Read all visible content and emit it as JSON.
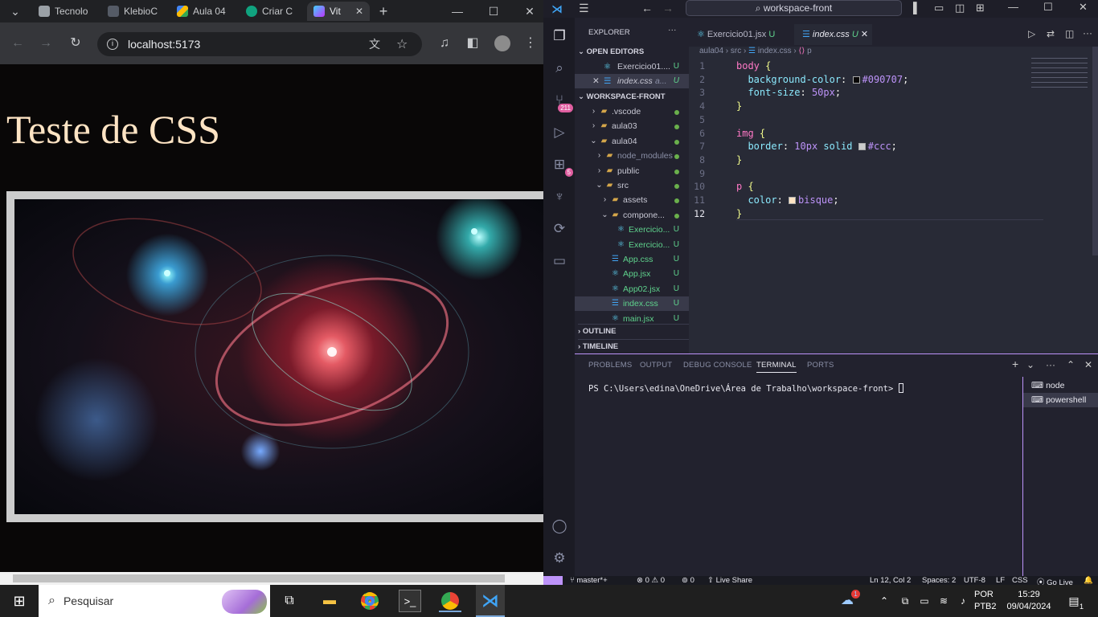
{
  "chrome": {
    "tabs": [
      {
        "label": "Tecnolo",
        "color": "#9aa0a6"
      },
      {
        "label": "KlebioC",
        "color": "#555b66"
      },
      {
        "label": "Aula 04",
        "color": "#4285f4"
      },
      {
        "label": "Criar C",
        "color": "#10a37f"
      },
      {
        "label": "Vit",
        "color": "#a259ff"
      }
    ],
    "new_tab": "+",
    "url": "localhost:5173",
    "page": {
      "heading": "Teste de CSS"
    }
  },
  "vscode": {
    "search": "workspace-front",
    "explorer_title": "EXPLORER",
    "open_editors_title": "OPEN EDITORS",
    "open_editors": [
      {
        "name": "Exercicio01....",
        "status": "U"
      },
      {
        "name": "index.css",
        "dir": "a...",
        "status": "U"
      }
    ],
    "workspace_title": "WORKSPACE-FRONT",
    "tree": [
      {
        "name": ".vscode",
        "kind": "folder",
        "depth": 0
      },
      {
        "name": "aula03",
        "kind": "folder",
        "depth": 0
      },
      {
        "name": "aula04",
        "kind": "folder-open",
        "depth": 0
      },
      {
        "name": "node_modules",
        "kind": "folder",
        "depth": 1
      },
      {
        "name": "public",
        "kind": "folder",
        "depth": 1
      },
      {
        "name": "src",
        "kind": "folder-open",
        "depth": 1
      },
      {
        "name": "assets",
        "kind": "folder",
        "depth": 2
      },
      {
        "name": "compone...",
        "kind": "folder-open",
        "depth": 2
      },
      {
        "name": "Exercicio...",
        "kind": "react",
        "depth": 3,
        "status": "U"
      },
      {
        "name": "Exercicio...",
        "kind": "react",
        "depth": 3,
        "status": "U"
      },
      {
        "name": "App.css",
        "kind": "css",
        "depth": 2,
        "status": "U"
      },
      {
        "name": "App.jsx",
        "kind": "react",
        "depth": 2,
        "status": "U"
      },
      {
        "name": "App02.jsx",
        "kind": "react",
        "depth": 2,
        "status": "U"
      },
      {
        "name": "index.css",
        "kind": "css",
        "depth": 2,
        "status": "U"
      },
      {
        "name": "main.jsx",
        "kind": "react",
        "depth": 2,
        "status": "U"
      }
    ],
    "outline_title": "OUTLINE",
    "timeline_title": "TIMELINE",
    "editor_tabs": [
      {
        "name": "Exercicio01.jsx",
        "status": "U"
      },
      {
        "name": "index.css",
        "status": "U"
      }
    ],
    "breadcrumb": [
      "aula04",
      "src",
      "index.css",
      "p"
    ],
    "code_lines": [
      "1",
      "2",
      "3",
      "4",
      "5",
      "6",
      "7",
      "8",
      "9",
      "10",
      "11",
      "12"
    ],
    "code": {
      "l1": {
        "sel": "body",
        "brace": " {"
      },
      "l2": {
        "prop": "background-color",
        "val": "#090707",
        "swatch": "#090707"
      },
      "l3": {
        "prop": "font-size",
        "val": "50px"
      },
      "l4": "}",
      "l6": {
        "sel": "img",
        "brace": " {"
      },
      "l7": {
        "prop": "border",
        "num": "10px",
        "kw": "solid",
        "val": "#ccc",
        "swatch": "#cccccc"
      },
      "l8": "}",
      "l10": {
        "sel": "p",
        "brace": " {"
      },
      "l11": {
        "prop": "color",
        "val": "bisque",
        "swatch": "#ffe4c4"
      },
      "l12": "}"
    },
    "panel_tabs": [
      "PROBLEMS",
      "OUTPUT",
      "DEBUG CONSOLE",
      "TERMINAL",
      "PORTS"
    ],
    "terminal_prompt": "PS C:\\Users\\edina\\OneDrive\\Área de Trabalho\\workspace-front>",
    "terminals": [
      "node",
      "powershell"
    ],
    "activity_badges": {
      "git": "211",
      "ext": "5"
    },
    "status": {
      "branch": "master*+",
      "errors": "0",
      "warnings": "0",
      "ports": "0",
      "live_share": "Live Share",
      "position": "Ln 12, Col 2",
      "spaces": "Spaces: 2",
      "encoding": "UTF-8",
      "eol": "LF",
      "language": "CSS",
      "golive": "Go Live"
    }
  },
  "taskbar": {
    "search": "Pesquisar",
    "lang": "POR",
    "layout": "PTB2",
    "time": "15:29",
    "date": "09/04/2024",
    "weather_badge": "1",
    "notif_count": "1"
  },
  "colors": {
    "page_bg": "#090707",
    "heading": "#ffe4c4",
    "border": "#cccccc",
    "accent": "#bd93f9"
  }
}
